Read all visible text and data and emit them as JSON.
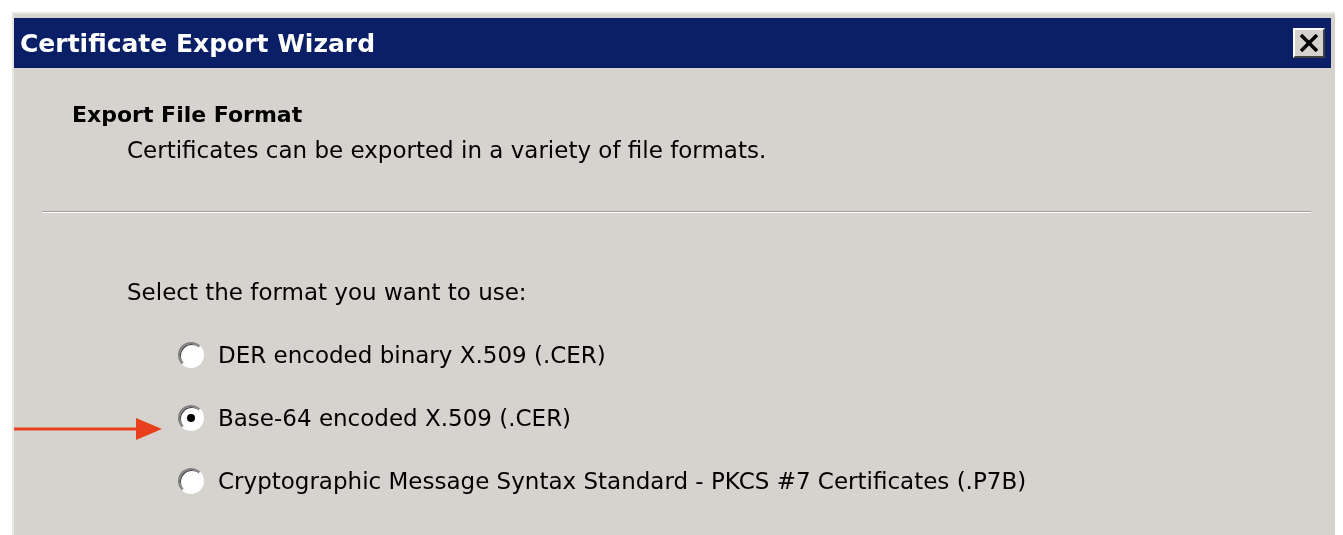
{
  "window": {
    "title": "Certificate Export Wizard"
  },
  "page": {
    "heading": "Export File Format",
    "description": "Certificates can be exported in a variety of file formats."
  },
  "format_prompt": "Select the format you want to use:",
  "formats": [
    {
      "label": "DER encoded binary X.509 (.CER)",
      "selected": false
    },
    {
      "label": "Base-64 encoded X.509 (.CER)",
      "selected": true
    },
    {
      "label": "Cryptographic Message Syntax Standard - PKCS #7 Certificates (.P7B)",
      "selected": false
    }
  ]
}
